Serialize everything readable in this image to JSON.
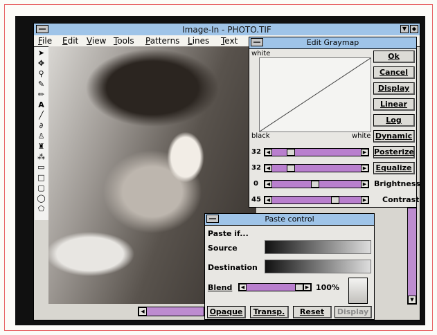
{
  "app": {
    "title": "Image-In - PHOTO.TIF"
  },
  "menu": [
    "File",
    "Edit",
    "View",
    "Tools",
    "Patterns",
    "Lines",
    "Text"
  ],
  "tools": [
    "arrow-icon",
    "move-icon",
    "zoom-icon",
    "eyedropper-icon",
    "pencil-icon",
    "text-icon",
    "line-icon",
    "lasso-icon",
    "fill-icon",
    "brush-icon",
    "spray-icon",
    "eraser-icon",
    "rectangle-icon",
    "rounded-rect-icon",
    "ellipse-icon",
    "polygon-icon"
  ],
  "graymap": {
    "title": "Edit Graymap",
    "white_top": "white",
    "black": "black",
    "white_bottom": "white",
    "buttons": [
      "Ok",
      "Cancel",
      "Display",
      "Linear",
      "Log",
      "Dynamic",
      "Posterize",
      "Equalize"
    ],
    "rows": [
      {
        "value": "32",
        "level": 0.18,
        "action": "Posterize",
        "is_button": true
      },
      {
        "value": "32",
        "level": 0.18,
        "action": "Equalize",
        "is_button": true
      },
      {
        "value": "0",
        "level": 0.48,
        "action": "Brightness",
        "is_button": false
      },
      {
        "value": "45",
        "level": 0.73,
        "action": "Contrast",
        "is_button": false
      }
    ]
  },
  "paste": {
    "title": "Paste control",
    "paste_if": "Paste if...",
    "source": "Source",
    "destination": "Destination",
    "blend_label": "Blend",
    "blend_value": "100%",
    "blend_level": 1.0,
    "buttons": [
      "Opaque",
      "Transp.",
      "Reset",
      "Display"
    ]
  },
  "colors": {
    "accent": "#9fc4e8",
    "slider": "#b97fce"
  }
}
